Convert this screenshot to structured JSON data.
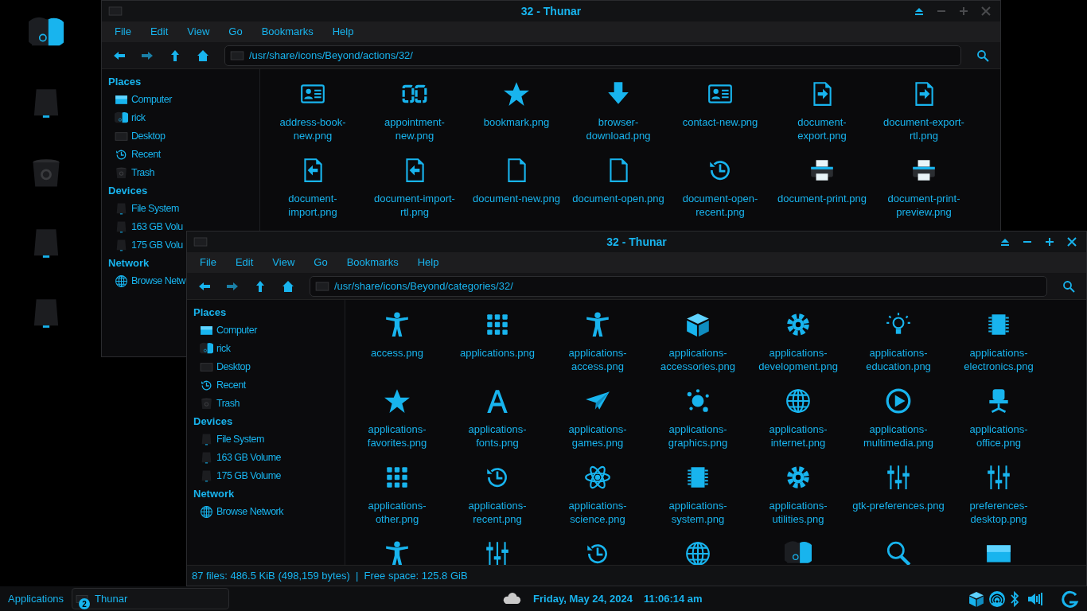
{
  "desktop_icons": [
    {
      "kind": "disc"
    },
    {
      "kind": "drive"
    },
    {
      "kind": "trash"
    },
    {
      "kind": "drive"
    },
    {
      "kind": "drive"
    }
  ],
  "windows": [
    {
      "title": "32 - Thunar",
      "active": false,
      "menu": [
        "File",
        "Edit",
        "View",
        "Go",
        "Bookmarks",
        "Help"
      ],
      "path": "/usr/share/icons/Beyond/actions/32/",
      "sidebar": [
        {
          "heading": "Places",
          "items": [
            {
              "label": "Computer",
              "kind": "monitor"
            },
            {
              "label": "rick",
              "kind": "disc"
            },
            {
              "label": "Desktop",
              "kind": "dark-screen"
            },
            {
              "label": "Recent",
              "kind": "clock"
            },
            {
              "label": "Trash",
              "kind": "trash"
            }
          ]
        },
        {
          "heading": "Devices",
          "items": [
            {
              "label": "File System",
              "kind": "drive"
            },
            {
              "label": "163 GB Volu",
              "kind": "drive"
            },
            {
              "label": "175 GB Volu",
              "kind": "drive"
            }
          ]
        },
        {
          "heading": "Network",
          "items": [
            {
              "label": "Browse Netw",
              "kind": "globe"
            }
          ]
        }
      ],
      "files": [
        {
          "name": "address-book-new.png",
          "kind": "id-card"
        },
        {
          "name": "appointment-new.png",
          "kind": "digits"
        },
        {
          "name": "bookmark.png",
          "kind": "star"
        },
        {
          "name": "browser-download.png",
          "kind": "download"
        },
        {
          "name": "contact-new.png",
          "kind": "id-card"
        },
        {
          "name": "document-export.png",
          "kind": "document-arrow-right"
        },
        {
          "name": "document-export-rtl.png",
          "kind": "document-arrow-right"
        },
        {
          "name": "document-import.png",
          "kind": "document-arrow-left"
        },
        {
          "name": "document-import-rtl.png",
          "kind": "document-arrow-left"
        },
        {
          "name": "document-new.png",
          "kind": "document"
        },
        {
          "name": "document-open.png",
          "kind": "document"
        },
        {
          "name": "document-open-recent.png",
          "kind": "clock"
        },
        {
          "name": "document-print.png",
          "kind": "printer"
        },
        {
          "name": "document-print-preview.png",
          "kind": "printer"
        }
      ]
    },
    {
      "title": "32 - Thunar",
      "active": true,
      "menu": [
        "File",
        "Edit",
        "View",
        "Go",
        "Bookmarks",
        "Help"
      ],
      "path": "/usr/share/icons/Beyond/categories/32/",
      "sidebar": [
        {
          "heading": "Places",
          "items": [
            {
              "label": "Computer",
              "kind": "monitor"
            },
            {
              "label": "rick",
              "kind": "disc"
            },
            {
              "label": "Desktop",
              "kind": "dark-screen"
            },
            {
              "label": "Recent",
              "kind": "clock"
            },
            {
              "label": "Trash",
              "kind": "trash"
            }
          ]
        },
        {
          "heading": "Devices",
          "items": [
            {
              "label": "File System",
              "kind": "drive"
            },
            {
              "label": "163 GB Volume",
              "kind": "drive"
            },
            {
              "label": "175 GB Volume",
              "kind": "drive"
            }
          ]
        },
        {
          "heading": "Network",
          "items": [
            {
              "label": "Browse Network",
              "kind": "globe"
            }
          ]
        }
      ],
      "files": [
        {
          "name": "access.png",
          "kind": "person"
        },
        {
          "name": "applications.png",
          "kind": "grid"
        },
        {
          "name": "applications-access.png",
          "kind": "person"
        },
        {
          "name": "applications-accessories.png",
          "kind": "box"
        },
        {
          "name": "applications-development.png",
          "kind": "gear"
        },
        {
          "name": "applications-education.png",
          "kind": "bulb"
        },
        {
          "name": "applications-electronics.png",
          "kind": "chip"
        },
        {
          "name": "applications-favorites.png",
          "kind": "star"
        },
        {
          "name": "applications-fonts.png",
          "kind": "letter"
        },
        {
          "name": "applications-games.png",
          "kind": "paper-plane"
        },
        {
          "name": "applications-graphics.png",
          "kind": "splash"
        },
        {
          "name": "applications-internet.png",
          "kind": "globe"
        },
        {
          "name": "applications-multimedia.png",
          "kind": "play"
        },
        {
          "name": "applications-office.png",
          "kind": "chair"
        },
        {
          "name": "applications-other.png",
          "kind": "grid"
        },
        {
          "name": "applications-recent.png",
          "kind": "clock"
        },
        {
          "name": "applications-science.png",
          "kind": "atom"
        },
        {
          "name": "applications-system.png",
          "kind": "chip"
        },
        {
          "name": "applications-utilities.png",
          "kind": "gear"
        },
        {
          "name": "gtk-preferences.png",
          "kind": "sliders"
        },
        {
          "name": "preferences-desktop.png",
          "kind": "sliders"
        },
        {
          "kind": "person"
        },
        {
          "kind": "sliders"
        },
        {
          "kind": "clock"
        },
        {
          "kind": "globe"
        },
        {
          "kind": "disc"
        },
        {
          "kind": "magnifier"
        },
        {
          "kind": "monitor"
        }
      ],
      "status_bar": "87 files: 486.5 KiB (498,159 bytes)  |  Free space: 125.8 GiB"
    }
  ],
  "taskbar": {
    "menu": "Applications",
    "tasks": [
      {
        "label": "Thunar",
        "count": "2"
      }
    ],
    "date": "Friday, May 24, 2024",
    "time": "11:06:14 am"
  }
}
